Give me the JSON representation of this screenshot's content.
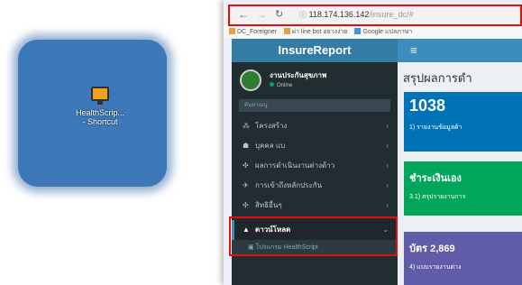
{
  "desktop": {
    "shortcut": {
      "icon": "monitor-icon",
      "label_line1": "HealthScrip...",
      "label_line2": "- Shortcut"
    }
  },
  "browser": {
    "url_host": "118.174.136.142",
    "url_path": "/insure_dc/#",
    "bookmarks": [
      {
        "label": "DC_Foreigner"
      },
      {
        "label": "ผ่า line bot อย่างง่าย"
      },
      {
        "label": "Google แปลภาษา"
      }
    ]
  },
  "app": {
    "brand": "InsureReport",
    "user": {
      "name": "งานประกันสุขภาพ",
      "status": "Online"
    },
    "search_placeholder": "ค้นหาเมนู",
    "menu": [
      {
        "icon": "sitemap-icon",
        "label": "โครงสร้าง"
      },
      {
        "icon": "users-icon",
        "label": "บุคคล แบ"
      },
      {
        "icon": "chart-icon",
        "label": "ผลการดำเนินงานต่างด้าว"
      },
      {
        "icon": "money-icon",
        "label": "การเข้าถึงหลักประกัน"
      },
      {
        "icon": "id-card-icon",
        "label": "สิทธิอื่นๆ"
      },
      {
        "icon": "download-icon",
        "label": "ดาวน์โหลด"
      }
    ],
    "submenu_item": "โปรแกรม HealthScript",
    "content_title": "สรุปผลการดำ",
    "boxes": [
      {
        "number": "1038",
        "desc": "1) รายงานข้อมูลด้า"
      },
      {
        "number": "ชำระเงินเอง",
        "desc": "3.1) สรุปรายงานการ"
      },
      {
        "number": "บัตร 2,869",
        "desc": "4) แบบรายงานต่าง"
      }
    ],
    "colors": {
      "header": "#3c8dbc",
      "logo": "#357ca5",
      "sidebar": "#222d32",
      "box_blue": "#0073b7",
      "box_green": "#00a65a",
      "box_purple": "#605ca8",
      "highlight": "#e01010"
    }
  }
}
